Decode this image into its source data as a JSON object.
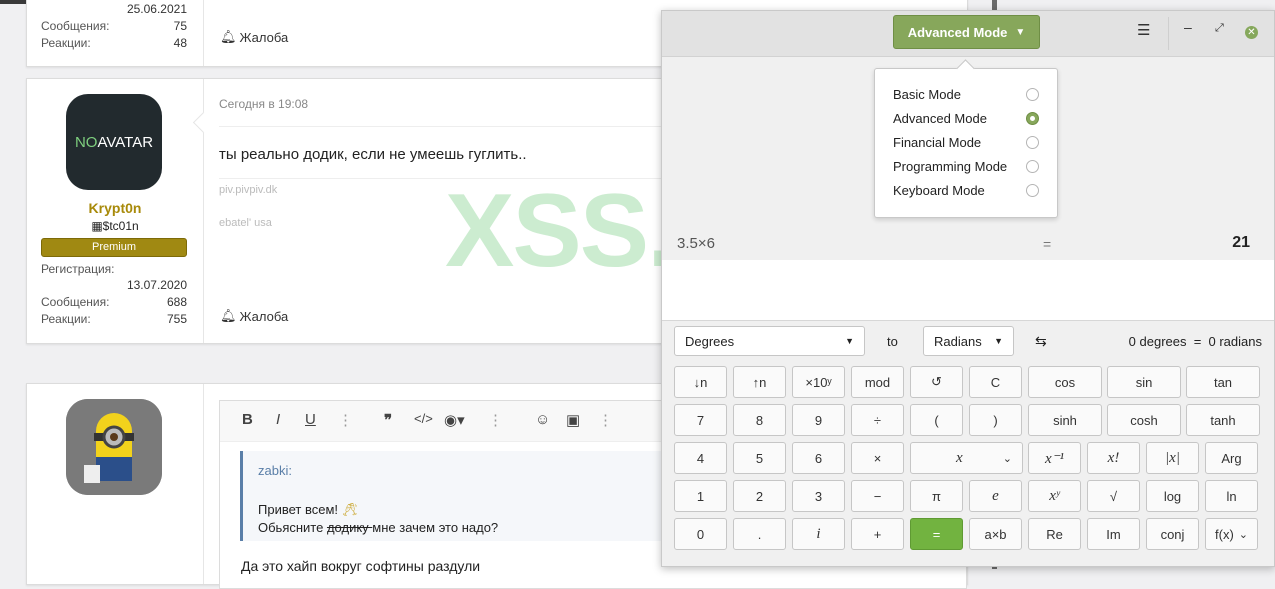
{
  "forum": {
    "post1": {
      "join_date": "25.06.2021",
      "messages_label": "Сообщения:",
      "messages": "75",
      "reactions_label": "Реакции:",
      "reactions": "48",
      "report": "Жалоба"
    },
    "post2": {
      "avatar_text_a": "NO",
      "avatar_text_b": "AVATAR",
      "username": "Krypt0n",
      "user_title": "$tc01n",
      "badge": "Premium",
      "reg_label": "Регистрация:",
      "reg_date": "13.07.2020",
      "messages_label": "Сообщения:",
      "messages": "688",
      "reactions_label": "Реакции:",
      "reactions": "755",
      "date": "Сегодня в 19:08",
      "message": "ты реально додик, если не умеешь гуглить..",
      "sig1": "piv.pivpiv.dk",
      "sig2": "ebatel' usa",
      "report": "Жалоба"
    },
    "editor": {
      "quote_author": "zabki:",
      "quote_line1": "Привет всем!",
      "quote_line2_struck": "додику ",
      "quote_line2_a": "Обьясните ",
      "quote_line2_b": "мне зачем это надо?",
      "draft": "Да это хайп вокруг софтины раздули"
    },
    "watermark": "XSS.is"
  },
  "calculator": {
    "mode_button": "Advanced Mode",
    "modes": [
      {
        "label": "Basic Mode",
        "selected": false
      },
      {
        "label": "Advanced Mode",
        "selected": true
      },
      {
        "label": "Financial Mode",
        "selected": false
      },
      {
        "label": "Programming Mode",
        "selected": false
      },
      {
        "label": "Keyboard Mode",
        "selected": false
      }
    ],
    "history": {
      "expression": "3.5×6",
      "equals": "=",
      "result": "21"
    },
    "conversion": {
      "from": "Degrees",
      "to_label": "to",
      "to": "Radians",
      "swap": "⇆",
      "result": "0 degrees  =  0 radians"
    },
    "keys": [
      [
        "↓n",
        "↑n",
        "×10ʸ",
        "mod",
        "↺",
        "C",
        "cos",
        "sin",
        "tan"
      ],
      [
        "7",
        "8",
        "9",
        "÷",
        "(",
        ")",
        "sinh",
        "cosh",
        "tanh"
      ],
      [
        "4",
        "5",
        "6",
        "×",
        "x",
        "x⁻¹",
        "x!",
        "|x|",
        "Arg"
      ],
      [
        "1",
        "2",
        "3",
        "−",
        "π",
        "e",
        "xʸ",
        "√",
        "log",
        "ln"
      ],
      [
        "0",
        ".",
        "i",
        "+",
        "=",
        "a×b",
        "Re",
        "Im",
        "conj",
        "f(x)"
      ]
    ],
    "accent": "#87a75b",
    "equals_color": "#72b340"
  }
}
